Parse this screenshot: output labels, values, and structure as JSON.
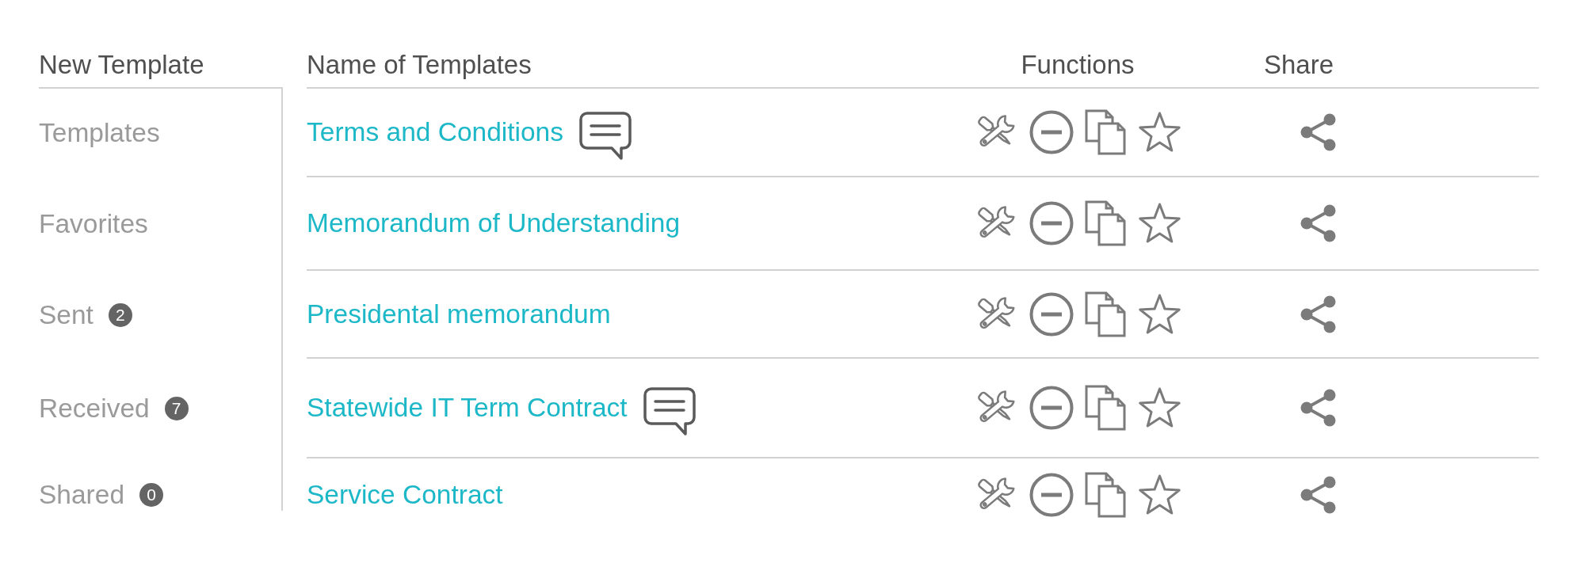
{
  "sidebar": {
    "header": "New Template",
    "items": [
      {
        "label": "Templates"
      },
      {
        "label": "Favorites"
      },
      {
        "label": "Sent",
        "count": "2"
      },
      {
        "label": "Received",
        "count": "7"
      },
      {
        "label": "Shared",
        "count": "0"
      }
    ]
  },
  "table": {
    "columns": [
      "Name of Templates",
      "Functions",
      "Share"
    ],
    "rows": [
      {
        "name": "Terms and Conditions",
        "comment": true
      },
      {
        "name": "Memorandum of Understanding",
        "comment": false
      },
      {
        "name": "Presidental memorandum",
        "comment": false
      },
      {
        "name": "Statewide IT Term Contract",
        "comment": true
      },
      {
        "name": "Service Contract",
        "comment": false
      }
    ]
  }
}
